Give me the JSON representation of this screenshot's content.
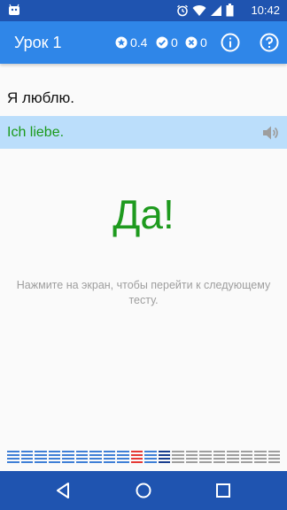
{
  "status_bar": {
    "time": "10:42",
    "icons": [
      "android-icon",
      "alarm-icon",
      "wifi-icon",
      "signal-icon",
      "battery-icon"
    ]
  },
  "app_bar": {
    "title": "Урок 1",
    "score": "0.4",
    "correct_count": "0",
    "wrong_count": "0",
    "icons": [
      "star-icon",
      "check-circle-icon",
      "x-circle-icon",
      "info-icon",
      "help-icon"
    ]
  },
  "exercise": {
    "prompt": "Я люблю.",
    "answer": "Ich liebe.",
    "result": "Да!",
    "hint": "Нажмите на экран, чтобы перейти к следующему тесту."
  },
  "progress": {
    "segments": [
      "blue",
      "blue",
      "blue",
      "blue",
      "blue",
      "blue",
      "blue",
      "blue",
      "blue",
      "red",
      "blue",
      "navy",
      "gray",
      "gray",
      "gray",
      "gray",
      "gray",
      "gray",
      "gray",
      "gray"
    ],
    "colors": {
      "blue": "#3f7fd6",
      "red": "#e53935",
      "navy": "#1a3f8f",
      "gray": "#9e9e9e"
    }
  },
  "nav_bar": {
    "icons": [
      "back-icon",
      "home-icon",
      "recents-icon"
    ]
  },
  "theme": {
    "status_bar": "#1f54b0",
    "app_bar": "#2f86e8",
    "answer_background": "#bbdefb",
    "answer_text": "#1b9a1b",
    "result_text": "#1e9a1e"
  }
}
